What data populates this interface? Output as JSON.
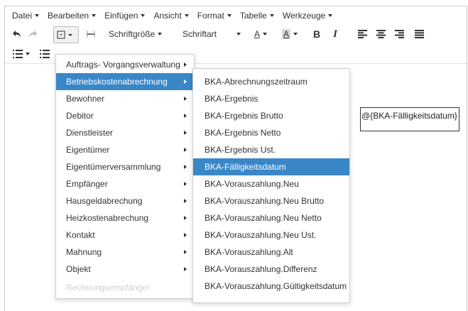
{
  "menubar": [
    {
      "label": "Datei",
      "name": "menu-datei"
    },
    {
      "label": "Bearbeiten",
      "name": "menu-bearbeiten"
    },
    {
      "label": "Einfügen",
      "name": "menu-einfuegen"
    },
    {
      "label": "Ansicht",
      "name": "menu-ansicht"
    },
    {
      "label": "Format",
      "name": "menu-format"
    },
    {
      "label": "Tabelle",
      "name": "menu-tabelle"
    },
    {
      "label": "Werkzeuge",
      "name": "menu-werkzeuge"
    }
  ],
  "toolbar": {
    "font_size_label": "Schriftgröße",
    "font_family_label": "Schriftart",
    "text_color_glyph": "A",
    "bg_color_glyph": "A",
    "bold_glyph": "B",
    "italic_glyph": "I",
    "icons": [
      "undo-icon",
      "redo-icon",
      "insert-placeholder-icon",
      "horizontal-rule-icon",
      "align-left-icon",
      "align-center-icon",
      "align-right-icon",
      "align-justify-icon",
      "bullet-list-icon",
      "numbered-list-icon"
    ]
  },
  "content": {
    "placeholder_text": "@{BKA-Fälligkeitsdatum}"
  },
  "submenu_level1": [
    {
      "label": "Auftrags- Vorgangsverwaltung"
    },
    {
      "label": "Betriebskostenabrechnung",
      "active": true
    },
    {
      "label": "Bewohner"
    },
    {
      "label": "Debitor"
    },
    {
      "label": "Dienstleister"
    },
    {
      "label": "Eigentümer"
    },
    {
      "label": "Eigentümerversammlung"
    },
    {
      "label": "Empfänger"
    },
    {
      "label": "Hausgeldabrechung"
    },
    {
      "label": "Heizkostenabrechung"
    },
    {
      "label": "Kontakt"
    },
    {
      "label": "Mahnung"
    },
    {
      "label": "Objekt"
    },
    {
      "label": "Rechnungsempfänger",
      "faded": true
    }
  ],
  "submenu_level2": [
    {
      "label": "BKA-Abrechnungszeitraum"
    },
    {
      "label": "BKA-Ergebnis"
    },
    {
      "label": "BKA-Ergebnis Brutto"
    },
    {
      "label": "BKA-Ergebnis Netto"
    },
    {
      "label": "BKA-Ergebnis Ust."
    },
    {
      "label": "BKA-Fälligkeitsdatum",
      "active": true
    },
    {
      "label": "BKA-Vorauszahlung.Neu"
    },
    {
      "label": "BKA-Vorauszahlung.Neu Brutto"
    },
    {
      "label": "BKA-Vorauszahlung.Neu Netto"
    },
    {
      "label": "BKA-Vorauszahlung.Neu Ust."
    },
    {
      "label": "BKA-Vorauszahlung.Alt"
    },
    {
      "label": "BKA-Vorauszahlung.Differenz"
    },
    {
      "label": "BKA-Vorauszahlung.Gültigkeitsdatum"
    }
  ],
  "colors": {
    "accent": "#3a87c8",
    "border": "#c8c8c8",
    "text": "#333333"
  }
}
